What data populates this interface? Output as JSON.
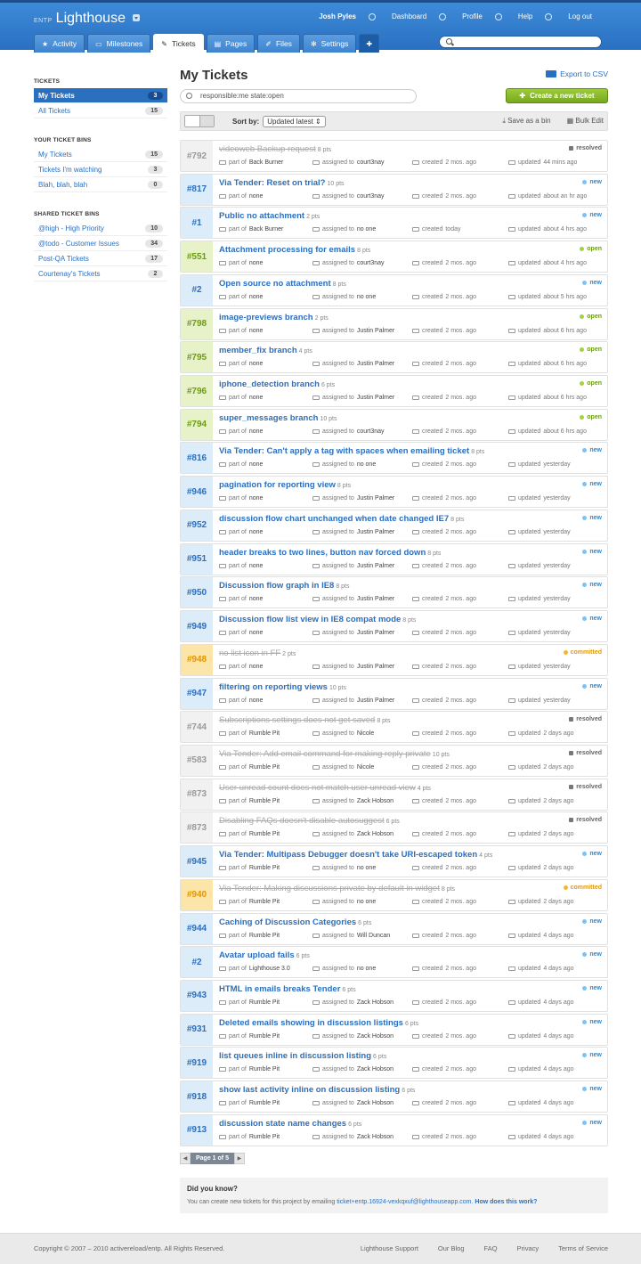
{
  "header": {
    "org": "ENTP",
    "app": "Lighthouse",
    "user": "Josh Pyles",
    "nav": [
      "Dashboard",
      "Profile",
      "Help",
      "Log out"
    ],
    "tabs": [
      {
        "label": "Activity",
        "icon": "star-icon"
      },
      {
        "label": "Milestones",
        "icon": "milestone-icon"
      },
      {
        "label": "Tickets",
        "icon": "ticket-icon"
      },
      {
        "label": "Pages",
        "icon": "page-icon"
      },
      {
        "label": "Files",
        "icon": "paperclip-icon"
      },
      {
        "label": "Settings",
        "icon": "gear-icon"
      }
    ]
  },
  "sidebar": {
    "tickets_heading": "TICKETS",
    "tickets": [
      {
        "label": "My Tickets",
        "count": "3"
      },
      {
        "label": "All Tickets",
        "count": "15"
      }
    ],
    "bins_heading": "YOUR TICKET BINS",
    "bins": [
      {
        "label": "My Tickets",
        "count": "15"
      },
      {
        "label": "Tickets I'm watching",
        "count": "3"
      },
      {
        "label": "Blah, blah, blah",
        "count": "0"
      }
    ],
    "shared_heading": "SHARED TICKET BINS",
    "shared": [
      {
        "label": "@high - High Priority",
        "count": "10"
      },
      {
        "label": "@todo - Customer Issues",
        "count": "34"
      },
      {
        "label": "Post-QA Tickets",
        "count": "17"
      },
      {
        "label": "Courtenay's Tickets",
        "count": "2"
      }
    ]
  },
  "main": {
    "title": "My Tickets",
    "export": "Export to CSV",
    "query": "responsible:me state:open",
    "new_ticket": "Create a new ticket",
    "sort_label": "Sort by:",
    "sort_value": "Updated latest",
    "save_bin": "Save as a bin",
    "bulk_edit": "Bulk Edit",
    "labels": {
      "part_of": "part of",
      "assigned_to": "assigned to",
      "created": "created",
      "updated": "updated"
    },
    "page": "Page 1 of 5"
  },
  "tickets": [
    {
      "num": "#792",
      "title": "videoweb Backup request",
      "pts": "8 pts",
      "state": "resolved",
      "part": "Back Burner",
      "assigned": "court3nay",
      "created": "2 mos. ago",
      "updated": "44 mins ago"
    },
    {
      "num": "#817",
      "title": "Via Tender: Reset on trial?",
      "pts": "10 pts",
      "state": "new",
      "part": "none",
      "assigned": "court3nay",
      "created": "2 mos. ago",
      "updated": "about an hr ago"
    },
    {
      "num": "#1",
      "title": "Public no attachment",
      "pts": "2 pts",
      "state": "new",
      "part": "Back Burner",
      "assigned": "no one",
      "created": "today",
      "updated": "about 4 hrs ago"
    },
    {
      "num": "#551",
      "title": "Attachment processing for emails",
      "pts": "8 pts",
      "state": "open",
      "part": "none",
      "assigned": "court3nay",
      "created": "2 mos. ago",
      "updated": "about 4 hrs ago"
    },
    {
      "num": "#2",
      "title": "Open source no attachment",
      "pts": "8 pts",
      "state": "new",
      "part": "none",
      "assigned": "no one",
      "created": "2 mos. ago",
      "updated": "about 5 hrs ago"
    },
    {
      "num": "#798",
      "title": "image-previews branch",
      "pts": "2 pts",
      "state": "open",
      "part": "none",
      "assigned": "Justin Palmer",
      "created": "2 mos. ago",
      "updated": "about 6 hrs ago"
    },
    {
      "num": "#795",
      "title": "member_fix branch",
      "pts": "4 pts",
      "state": "open",
      "part": "none",
      "assigned": "Justin Palmer",
      "created": "2 mos. ago",
      "updated": "about 6 hrs ago"
    },
    {
      "num": "#796",
      "title": "iphone_detection branch",
      "pts": "6 pts",
      "state": "open",
      "part": "none",
      "assigned": "Justin Palmer",
      "created": "2 mos. ago",
      "updated": "about 6 hrs ago"
    },
    {
      "num": "#794",
      "title": "super_messages branch",
      "pts": "10 pts",
      "state": "open",
      "part": "none",
      "assigned": "court3nay",
      "created": "2 mos. ago",
      "updated": "about 6 hrs ago"
    },
    {
      "num": "#816",
      "title": "Via Tender: Can't apply a tag with spaces when emailing ticket",
      "pts": "8 pts",
      "state": "new",
      "part": "none",
      "assigned": "no one",
      "created": "2 mos. ago",
      "updated": "yesterday"
    },
    {
      "num": "#946",
      "title": "pagination for reporting view",
      "pts": "8 pts",
      "state": "new",
      "part": "none",
      "assigned": "Justin Palmer",
      "created": "2 mos. ago",
      "updated": "yesterday"
    },
    {
      "num": "#952",
      "title": "discussion flow chart unchanged when date changed IE7",
      "pts": "8 pts",
      "state": "new",
      "part": "none",
      "assigned": "Justin Palmer",
      "created": "2 mos. ago",
      "updated": "yesterday"
    },
    {
      "num": "#951",
      "title": "header breaks to two lines, button nav forced down",
      "pts": "8 pts",
      "state": "new",
      "part": "none",
      "assigned": "Justin Palmer",
      "created": "2 mos. ago",
      "updated": "yesterday"
    },
    {
      "num": "#950",
      "title": "Discussion flow graph in IE8",
      "pts": "8 pts",
      "state": "new",
      "part": "none",
      "assigned": "Justin Palmer",
      "created": "2 mos. ago",
      "updated": "yesterday"
    },
    {
      "num": "#949",
      "title": "Discussion flow list view in IE8 compat mode",
      "pts": "8 pts",
      "state": "new",
      "part": "none",
      "assigned": "Justin Palmer",
      "created": "2 mos. ago",
      "updated": "yesterday"
    },
    {
      "num": "#948",
      "title": "no list icon in FF",
      "pts": "2 pts",
      "state": "committed",
      "part": "none",
      "assigned": "Justin Palmer",
      "created": "2 mos. ago",
      "updated": "yesterday"
    },
    {
      "num": "#947",
      "title": "filtering on reporting views",
      "pts": "10 pts",
      "state": "new",
      "part": "none",
      "assigned": "Justin Palmer",
      "created": "2 mos. ago",
      "updated": "yesterday"
    },
    {
      "num": "#744",
      "title": "Subscriptions settings does not get saved",
      "pts": "8 pts",
      "state": "resolved",
      "part": "Rumble Pit",
      "assigned": "Nicole",
      "created": "2 mos. ago",
      "updated": "2 days ago"
    },
    {
      "num": "#583",
      "title": "Via Tender: Add email command for making reply private",
      "pts": "10 pts",
      "state": "resolved",
      "part": "Rumble Pit",
      "assigned": "Nicole",
      "created": "2 mos. ago",
      "updated": "2 days ago"
    },
    {
      "num": "#873",
      "title": "User unread count does not match user unread view",
      "pts": "4 pts",
      "state": "resolved",
      "part": "Rumble Pit",
      "assigned": "Zack Hobson",
      "created": "2 mos. ago",
      "updated": "2 days ago"
    },
    {
      "num": "#873",
      "title": "Disabling FAQs doesn't disable autosuggest",
      "pts": "6 pts",
      "state": "resolved",
      "part": "Rumble Pit",
      "assigned": "Zack Hobson",
      "created": "2 mos. ago",
      "updated": "2 days ago"
    },
    {
      "num": "#945",
      "title": "Via Tender: Multipass Debugger doesn't take URI-escaped token",
      "pts": "4 pts",
      "state": "new",
      "part": "Rumble Pit",
      "assigned": "no one",
      "created": "2 mos. ago",
      "updated": "2 days ago"
    },
    {
      "num": "#940",
      "title": "Via Tender: Making discussions private by default in widget",
      "pts": "8 pts",
      "state": "committed",
      "part": "Rumble Pit",
      "assigned": "no one",
      "created": "2 mos. ago",
      "updated": "2 days ago"
    },
    {
      "num": "#944",
      "title": "Caching of Discussion Categories",
      "pts": "6 pts",
      "state": "new",
      "part": "Rumble Pit",
      "assigned": "Will Duncan",
      "created": "2 mos. ago",
      "updated": "4 days ago"
    },
    {
      "num": "#2",
      "title": "Avatar upload fails",
      "pts": "6 pts",
      "state": "new",
      "part": "Lighthouse 3.0",
      "assigned": "no one",
      "created": "2 mos. ago",
      "updated": "4 days ago"
    },
    {
      "num": "#943",
      "title": "HTML in emails breaks Tender",
      "pts": "6 pts",
      "state": "new",
      "part": "Rumble Pit",
      "assigned": "Zack Hobson",
      "created": "2 mos. ago",
      "updated": "4 days ago"
    },
    {
      "num": "#931",
      "title": "Deleted emails showing in discussion listings",
      "pts": "6 pts",
      "state": "new",
      "part": "Rumble Pit",
      "assigned": "Zack Hobson",
      "created": "2 mos. ago",
      "updated": "4 days ago"
    },
    {
      "num": "#919",
      "title": "list queues inline in discussion listing",
      "pts": "6 pts",
      "state": "new",
      "part": "Rumble Pit",
      "assigned": "Zack Hobson",
      "created": "2 mos. ago",
      "updated": "4 days ago"
    },
    {
      "num": "#918",
      "title": "show last activity inline on discussion listing",
      "pts": "6 pts",
      "state": "new",
      "part": "Rumble Pit",
      "assigned": "Zack Hobson",
      "created": "2 mos. ago",
      "updated": "4 days ago"
    },
    {
      "num": "#913",
      "title": "discussion state name changes",
      "pts": "6 pts",
      "state": "new",
      "part": "Rumble Pit",
      "assigned": "Zack Hobson",
      "created": "2 mos. ago",
      "updated": "4 days ago"
    }
  ],
  "tip": {
    "heading": "Did you know?",
    "text": "You can create new tickets for this project by emailing",
    "email": "ticket+entp.16924-vexkqxuf@lighthouseapp.com.",
    "link": "How does this work?"
  },
  "footer": {
    "copyright": "Copyright © 2007 – 2010 activereload/entp. All Rights Reserved.",
    "links": [
      "Lighthouse Support",
      "Our Blog",
      "FAQ",
      "Privacy",
      "Terms of Service"
    ]
  }
}
